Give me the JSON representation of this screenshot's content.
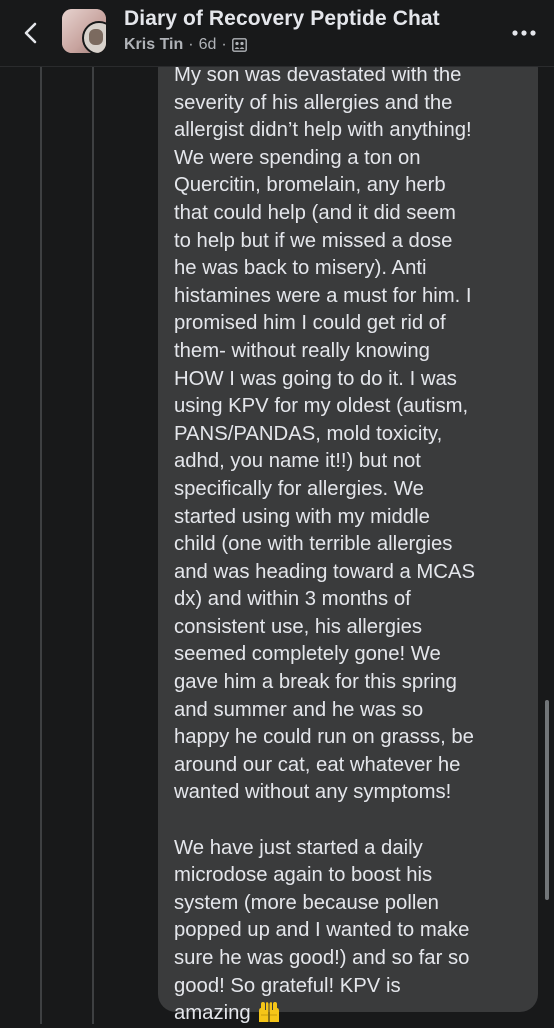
{
  "header": {
    "back_icon": "chevron-left-icon",
    "group_name": "Diary of Recovery Peptide Chat",
    "author": "Kris Tin",
    "time": "6d",
    "separator": "·",
    "privacy_icon": "group-icon",
    "more_icon": "more-dots-icon"
  },
  "comment": {
    "paragraph_1": "My son was devastated with the\nseverity of his allergies and the\nallergist didn’t help with anything!\nWe were spending a ton on\nQuercitin, bromelain, any herb\nthat could help (and it did seem\nto help but if we missed a dose\nhe was back to misery). Anti\nhistamines were a must for him. I\npromised him I could get rid of\nthem- without really knowing\nHOW I was going to do it. I was\nusing KPV for my oldest (autism,\nPANS/PANDAS, mold toxicity,\nadhd, you name it!!) but not\nspecifically for allergies. We\nstarted using with my middle\nchild (one with terrible allergies\nand was heading toward a MCAS\ndx) and within 3 months of\nconsistent use, his allergies\nseemed completely gone! We\ngave him a break for this spring\nand summer and he was so\nhappy he could run on grasss, be\naround our cat, eat whatever he\nwanted without any symptoms!",
    "paragraph_2": "We have just started a daily\nmicrodose again to boost his\nsystem (more because pollen\npopped up and I wanted to make\nsure he was good!) and so far so\ngood! So grateful! KPV is\namazing",
    "emoji": "raising-hands-emoji"
  },
  "colors": {
    "background": "#18191a",
    "bubble": "#3a3b3c",
    "text": "#e4e6eb",
    "secondary_text": "#b0b3b8",
    "emoji": "#f5c518"
  }
}
